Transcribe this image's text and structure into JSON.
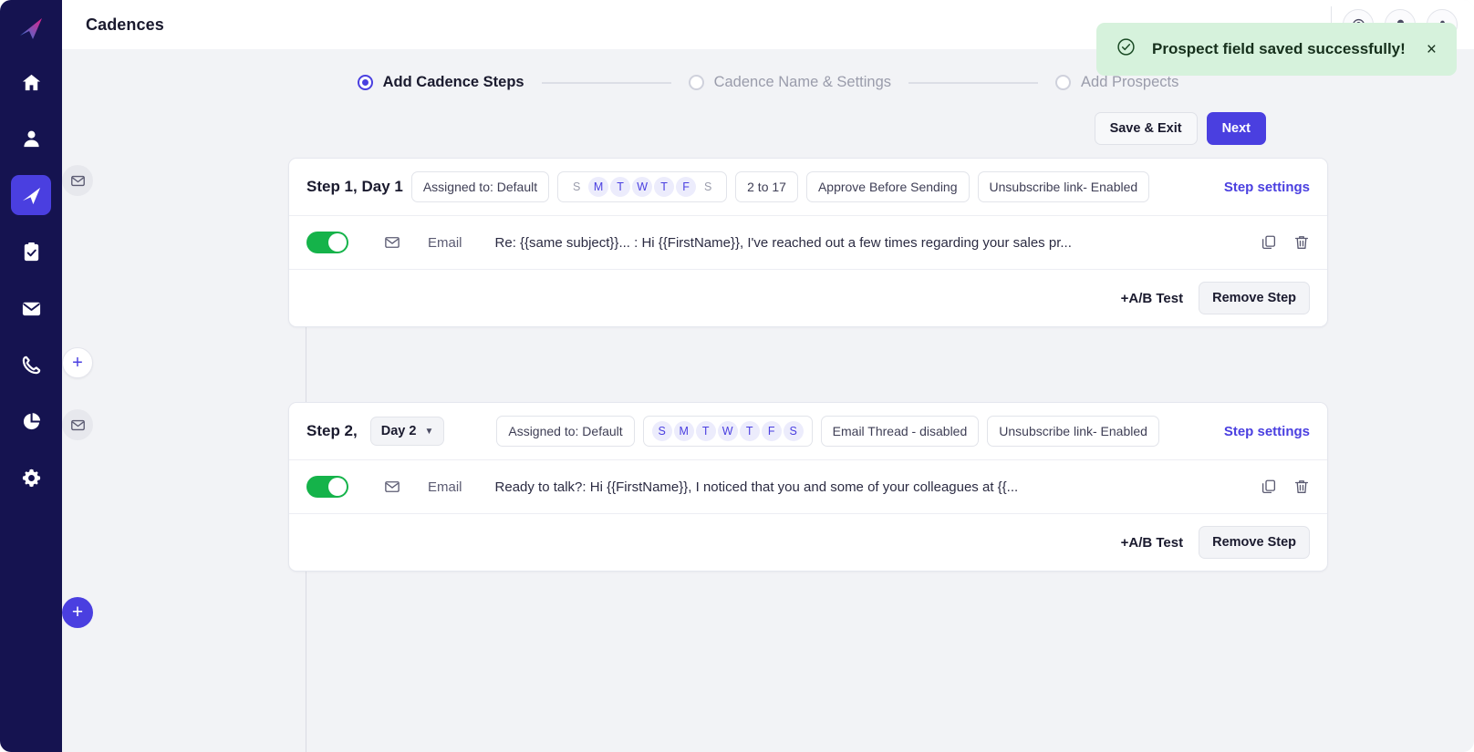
{
  "sidebar": {
    "logo": "paper-plane-logo",
    "items": [
      {
        "name": "home",
        "icon": "home-icon",
        "active": false
      },
      {
        "name": "prospects",
        "icon": "person-icon",
        "active": false
      },
      {
        "name": "cadences",
        "icon": "send-icon",
        "active": true
      },
      {
        "name": "tasks",
        "icon": "clipboard-check-icon",
        "active": false
      },
      {
        "name": "emails",
        "icon": "envelope-icon",
        "active": false
      },
      {
        "name": "calls",
        "icon": "phone-icon",
        "active": false
      },
      {
        "name": "reports",
        "icon": "pie-chart-icon",
        "active": false
      },
      {
        "name": "settings",
        "icon": "gear-icon",
        "active": false
      }
    ]
  },
  "topbar": {
    "title": "Cadences",
    "kebab": "more-options-icon",
    "help_icon": "help-icon",
    "notifications_icon": "bell-icon",
    "account_icon": "account-icon"
  },
  "toast": {
    "message": "Prospect field saved successfully!",
    "icon": "check-circle-icon",
    "close": "×",
    "bg_color": "#d6f2dc"
  },
  "stepper": {
    "steps": [
      {
        "label": "Add Cadence Steps",
        "state": "active"
      },
      {
        "label": "Cadence Name & Settings",
        "state": "inactive"
      },
      {
        "label": "Add Prospects",
        "state": "inactive"
      }
    ]
  },
  "actions": {
    "save_exit": "Save & Exit",
    "next": "Next",
    "primary_color": "#4a3fe0"
  },
  "cadence_steps": [
    {
      "title": "Step 1, Day 1",
      "has_day_select": false,
      "day_select": "",
      "assigned": "Assigned to: Default",
      "days": [
        {
          "letter": "S",
          "on": false
        },
        {
          "letter": "M",
          "on": true
        },
        {
          "letter": "T",
          "on": true
        },
        {
          "letter": "W",
          "on": true
        },
        {
          "letter": "T",
          "on": true
        },
        {
          "letter": "F",
          "on": true
        },
        {
          "letter": "S",
          "on": false
        }
      ],
      "time_range": "2 to 17",
      "approve": "Approve Before Sending",
      "unsubscribe": "Unsubscribe link- Enabled",
      "step_settings": "Step settings",
      "row": {
        "enabled": true,
        "type": "Email",
        "text": "Re: {{same subject}}... : Hi {{FirstName}}, I've reached out a few times regarding your sales pr...",
        "copy_icon": "copy-icon",
        "delete_icon": "trash-icon"
      },
      "ab_test": "+A/B Test",
      "remove_step": "Remove Step"
    },
    {
      "title": "Step 2,",
      "has_day_select": true,
      "day_select": "Day 2",
      "assigned": "Assigned to: Default",
      "days": [
        {
          "letter": "S",
          "on": true
        },
        {
          "letter": "M",
          "on": true
        },
        {
          "letter": "T",
          "on": true
        },
        {
          "letter": "W",
          "on": true
        },
        {
          "letter": "T",
          "on": true
        },
        {
          "letter": "F",
          "on": true
        },
        {
          "letter": "S",
          "on": true
        }
      ],
      "time_range": "",
      "approve": "Email Thread - disabled",
      "unsubscribe": "Unsubscribe link- Enabled",
      "step_settings": "Step settings",
      "row": {
        "enabled": true,
        "type": "Email",
        "text": "Ready to talk?: Hi {{FirstName}}, I noticed that you and some of your colleagues at {{...",
        "copy_icon": "copy-icon",
        "delete_icon": "trash-icon"
      },
      "ab_test": "+A/B Test",
      "remove_step": "Remove Step"
    }
  ],
  "rail": {
    "node_icon": "envelope-icon",
    "add_step_between": "+",
    "add_step_end": "+"
  }
}
